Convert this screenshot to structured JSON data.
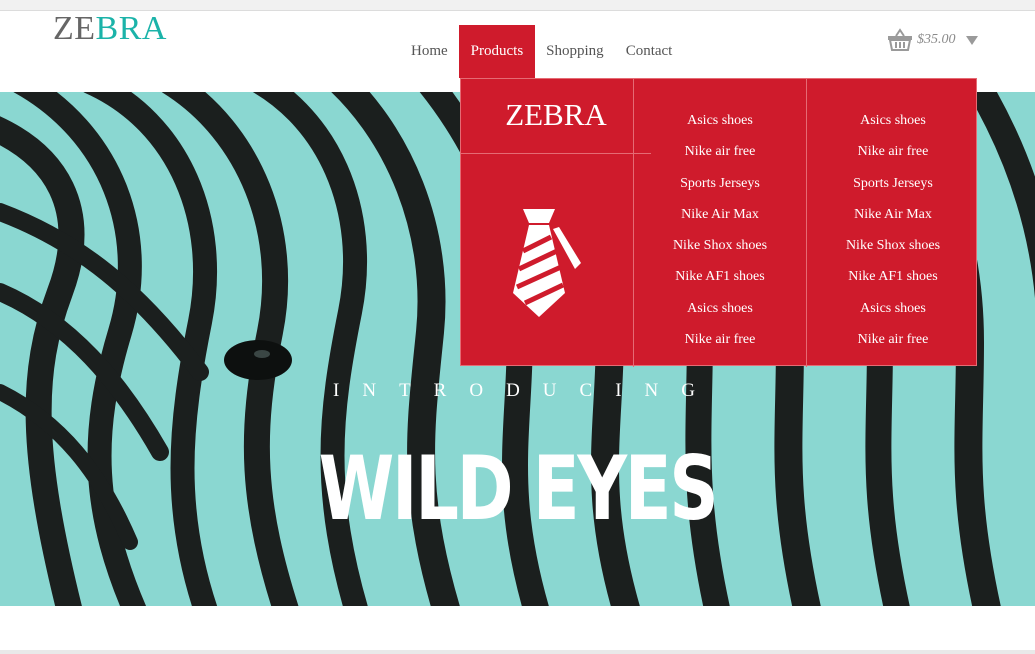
{
  "header": {
    "logo_part1": "ZE",
    "logo_part2": "BRA",
    "nav": [
      {
        "label": "Home"
      },
      {
        "label": "Products"
      },
      {
        "label": "Shopping"
      },
      {
        "label": "Contact"
      }
    ],
    "cart_total": "$35.00"
  },
  "mega_menu": {
    "brand": "ZEBRA",
    "icon": "necktie-icon",
    "columns": [
      [
        "Asics shoes",
        "Nike air free",
        "Sports Jerseys",
        "Nike Air Max",
        "Nike Shox shoes",
        "Nike AF1 shoes",
        "Asics shoes",
        "Nike air free"
      ],
      [
        "Asics shoes",
        "Nike air free",
        "Sports Jerseys",
        "Nike Air Max",
        "Nike Shox shoes",
        "Nike AF1 shoes",
        "Asics shoes",
        "Nike air free"
      ]
    ]
  },
  "hero": {
    "intro": "INTRODUCING",
    "title": "WILD EYES"
  },
  "colors": {
    "accent": "#cf1b2c",
    "teal": "#1bb3a9",
    "hero_bg": "#8ad7d1",
    "stripe": "#1b1f1e"
  }
}
